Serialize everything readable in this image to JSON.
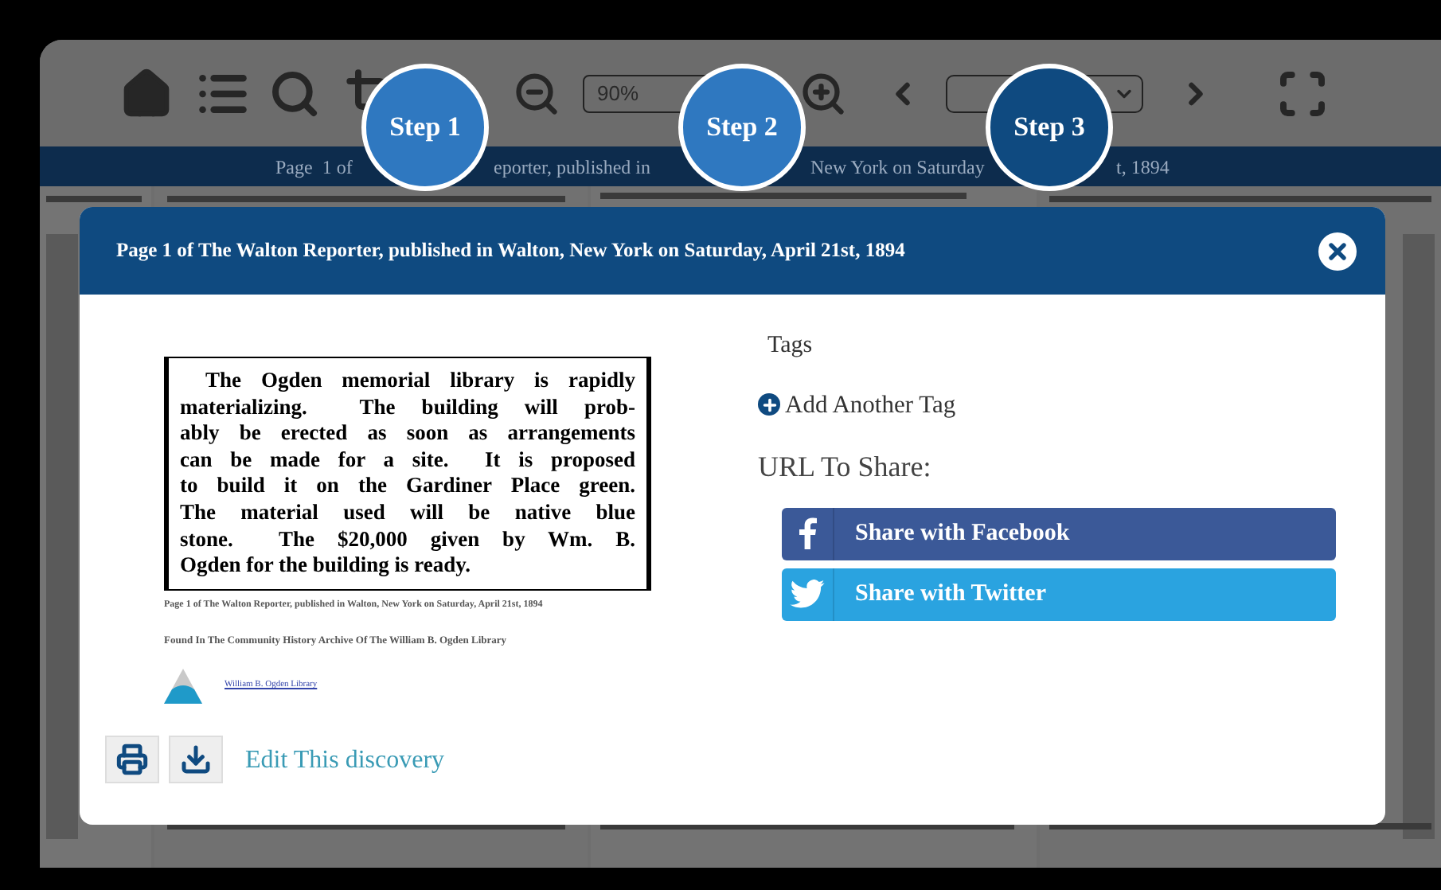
{
  "toolbar": {
    "zoom": "90%"
  },
  "title_bar": {
    "segments": [
      "Page  1 of",
      "eporter, published in",
      "New York on Saturday",
      "t, 1894"
    ]
  },
  "steps": [
    {
      "label": "Step 1",
      "selected": false
    },
    {
      "label": "Step 2",
      "selected": false
    },
    {
      "label": "Step 3",
      "selected": true
    }
  ],
  "modal": {
    "title": "Page 1 of The Walton Reporter, published in Walton, New York on Saturday, April 21st, 1894",
    "clipping": {
      "lines": [
        "The Ogden memorial library is rapidly",
        "materializing.  The building will prob-",
        "ably be erected as soon as arrangements",
        "can be made for a site.  It is proposed",
        "to build it on the Gardiner Place green.",
        "The material used will be native blue",
        "stone.  The $20,000 given by Wm. B.",
        "Ogden for the building is ready."
      ],
      "caption": "Page 1 of The Walton Reporter, published in Walton, New York on Saturday, April 21st, 1894",
      "source": "Found In The Community History Archive Of The William B. Ogden Library",
      "link": "William B. Ogden Library"
    },
    "tags_heading": "Tags",
    "add_tag": "Add Another Tag",
    "share_heading": "URL To Share:",
    "share_buttons": [
      {
        "kind": "facebook",
        "label": "Share with Facebook"
      },
      {
        "kind": "twitter",
        "label": "Share with Twitter"
      }
    ],
    "edit_link": "Edit This discovery"
  }
}
